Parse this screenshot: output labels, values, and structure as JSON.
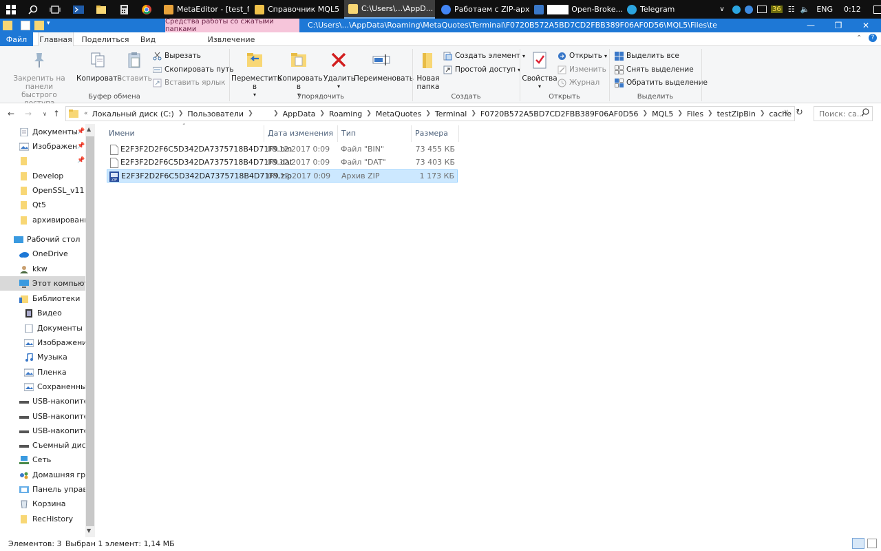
{
  "taskbar": {
    "tasks": [
      {
        "label": "MetaEditor - [test_fi...",
        "active": false
      },
      {
        "label": "Справочник MQL5",
        "active": false
      },
      {
        "label": "C:\\Users\\...\\AppD...",
        "active": true
      },
      {
        "label": "Работаем с ZIP-арх...",
        "active": false
      },
      {
        "label": "Open-Broke...",
        "active": false
      },
      {
        "label": "Telegram",
        "active": false
      }
    ],
    "tray": {
      "badge": "36",
      "language": "ENG",
      "time": "0:12"
    }
  },
  "window": {
    "context_tab": "Средства работы со сжатыми папками",
    "title_path": "C:\\Users\\...\\AppData\\Roaming\\MetaQuotes\\Terminal\\F0720B572A5BD7CD2FBB389F06AF0D56\\MQL5\\Files\\te"
  },
  "ribbon_tabs": {
    "file": "Файл",
    "home": "Главная",
    "share": "Поделиться",
    "view": "Вид",
    "extract": "Извлечение"
  },
  "ribbon": {
    "clipboard": {
      "pin": "Закрепить на панели быстрого доступа",
      "copy": "Копировать",
      "paste": "Вставить",
      "cut": "Вырезать",
      "copy_path": "Скопировать путь",
      "paste_shortcut": "Вставить ярлык",
      "label": "Буфер обмена"
    },
    "organize": {
      "move": "Переместить в",
      "copy_to": "Копировать в",
      "delete": "Удалить",
      "rename": "Переименовать",
      "label": "Упорядочить"
    },
    "new": {
      "new_folder": "Новая папка",
      "new_item": "Создать элемент",
      "easy_access": "Простой доступ",
      "label": "Создать"
    },
    "open": {
      "properties": "Свойства",
      "open": "Открыть",
      "edit": "Изменить",
      "history": "Журнал",
      "label": "Открыть"
    },
    "select": {
      "select_all": "Выделить все",
      "select_none": "Снять выделение",
      "invert": "Обратить выделение",
      "label": "Выделить"
    }
  },
  "address": {
    "crumbs": [
      "Локальный диск (C:)",
      "Пользователи",
      "AppData",
      "Roaming",
      "MetaQuotes",
      "Terminal",
      "F0720B572A5BD7CD2FBB389F06AF0D56",
      "MQL5",
      "Files",
      "testZipBin",
      "cache"
    ],
    "search_placeholder": "Поиск: ca..."
  },
  "nav": {
    "items": [
      {
        "label": "Документы",
        "pinned": true
      },
      {
        "label": "Изображени",
        "pinned": true
      },
      {
        "label": "",
        "pinned": true
      },
      {
        "label": "Develop",
        "pinned": false
      },
      {
        "label": "OpenSSL_v11",
        "pinned": false
      },
      {
        "label": "Qt5",
        "pinned": false
      },
      {
        "label": "архивирование",
        "pinned": false
      },
      {
        "label": "Рабочий стол",
        "pinned": false
      },
      {
        "label": "OneDrive",
        "pinned": false
      },
      {
        "label": "kkw",
        "pinned": false
      },
      {
        "label": "Этот компьютер",
        "pinned": false
      },
      {
        "label": "Библиотеки",
        "pinned": false
      },
      {
        "label": "Видео",
        "pinned": false
      },
      {
        "label": "Документы",
        "pinned": false
      },
      {
        "label": "Изображения",
        "pinned": false
      },
      {
        "label": "Музыка",
        "pinned": false
      },
      {
        "label": "Пленка",
        "pinned": false
      },
      {
        "label": "Сохраненные",
        "pinned": false
      },
      {
        "label": "USB-накопител",
        "pinned": false
      },
      {
        "label": "USB-накопител",
        "pinned": false
      },
      {
        "label": "USB-накопител",
        "pinned": false
      },
      {
        "label": "Съемный диск",
        "pinned": false
      },
      {
        "label": "Сеть",
        "pinned": false
      },
      {
        "label": "Домашняя груп",
        "pinned": false
      },
      {
        "label": "Панель управле",
        "pinned": false
      },
      {
        "label": "Корзина",
        "pinned": false
      },
      {
        "label": "RecHistory",
        "pinned": false
      }
    ]
  },
  "files": {
    "columns": {
      "name": "Имени",
      "date": "Дата изменения",
      "type": "Тип",
      "size": "Размера"
    },
    "rows": [
      {
        "name": "E2F3F2D2F6C5D342DA7375718B4D71F9.bin",
        "date": "08.12.2017 0:09",
        "type": "Файл \"BIN\"",
        "size": "73 455 КБ",
        "selected": false
      },
      {
        "name": "E2F3F2D2F6C5D342DA7375718B4D71F9.dat",
        "date": "08.12.2017 0:09",
        "type": "Файл \"DAT\"",
        "size": "73 403 КБ",
        "selected": false
      },
      {
        "name": "E2F3F2D2F6C5D342DA7375718B4D71F9.zip",
        "date": "08.12.2017 0:09",
        "type": "Архив ZIP",
        "size": "1 173 КБ",
        "selected": true
      }
    ]
  },
  "status": {
    "count": "Элементов: 3",
    "selection": "Выбран 1 элемент: 1,14 МБ"
  },
  "colors": {
    "accent": "#1e78d6",
    "selection": "#cce8ff",
    "context_tab": "#f6c5da",
    "folder": "#f8d775"
  }
}
